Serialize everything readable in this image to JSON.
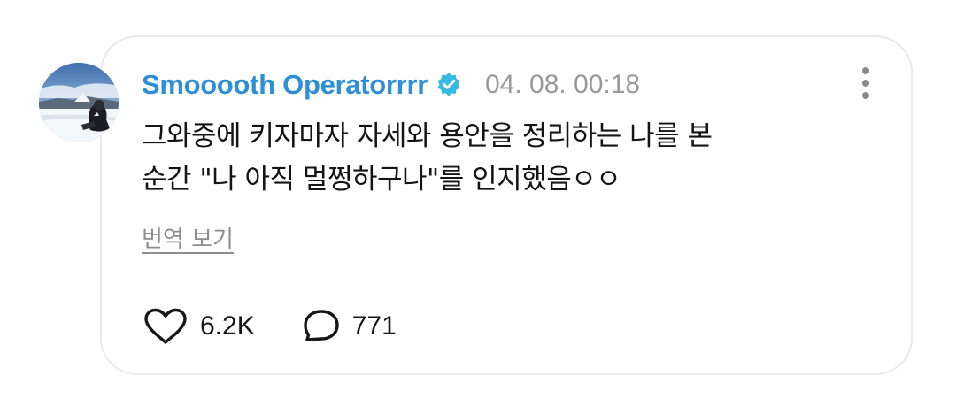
{
  "comment": {
    "username": "Smooooth Operatorrrr",
    "verified_icon": "verified-badge-icon",
    "timestamp": "04. 08. 00:18",
    "lines": [
      "그와중에 키자마자 자세와 용안을 정리하는 나를 본",
      "순간 \"나 아직 멀쩡하구나\"를 인지했음ㅇㅇ"
    ],
    "translate_link": "번역 보기",
    "likes": "6.2K",
    "replies": "771"
  },
  "colors": {
    "username": "#2e8fd6",
    "verified": "#35b9e3",
    "timestamp": "#9a9a9a",
    "text": "#141414",
    "card_border": "#e9e9e9"
  },
  "icons": {
    "avatar": "avatar-photo",
    "more": "more-vertical-icon",
    "like": "heart-icon",
    "reply": "speech-bubble-icon"
  }
}
